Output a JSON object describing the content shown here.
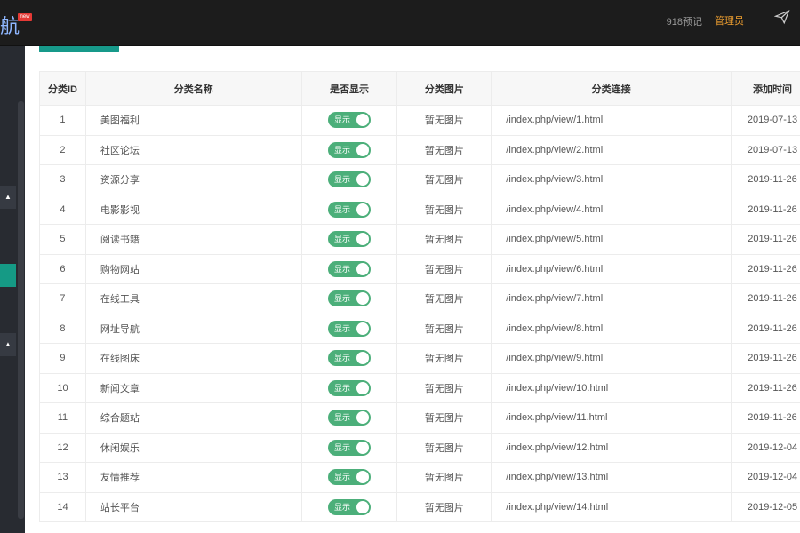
{
  "header": {
    "logo_text": "航",
    "logo_badge": "new",
    "stat_text": "918预记",
    "admin_label": "管理员",
    "send_icon": "paper-plane-icon"
  },
  "sidebar": {
    "items": [
      {
        "icon": "chevron-up-icon",
        "glyph": "▲"
      },
      {
        "icon": "chevron-up-icon",
        "glyph": "▲"
      }
    ],
    "active_color": "#159a85"
  },
  "colors": {
    "accent": "#17998a",
    "toggle_on": "#4caf7a"
  },
  "table": {
    "columns": [
      "分类ID",
      "分类名称",
      "是否显示",
      "分类图片",
      "分类连接",
      "添加时间"
    ],
    "toggle_label": "显示",
    "rows": [
      {
        "id": "1",
        "name": "美图福利",
        "show": "显示",
        "image": "暂无图片",
        "link": "/index.php/view/1.html",
        "time": "2019-07-13"
      },
      {
        "id": "2",
        "name": "社区论坛",
        "show": "显示",
        "image": "暂无图片",
        "link": "/index.php/view/2.html",
        "time": "2019-07-13"
      },
      {
        "id": "3",
        "name": "资源分享",
        "show": "显示",
        "image": "暂无图片",
        "link": "/index.php/view/3.html",
        "time": "2019-11-26"
      },
      {
        "id": "4",
        "name": "电影影视",
        "show": "显示",
        "image": "暂无图片",
        "link": "/index.php/view/4.html",
        "time": "2019-11-26"
      },
      {
        "id": "5",
        "name": "阅读书籍",
        "show": "显示",
        "image": "暂无图片",
        "link": "/index.php/view/5.html",
        "time": "2019-11-26"
      },
      {
        "id": "6",
        "name": "购物网站",
        "show": "显示",
        "image": "暂无图片",
        "link": "/index.php/view/6.html",
        "time": "2019-11-26"
      },
      {
        "id": "7",
        "name": "在线工具",
        "show": "显示",
        "image": "暂无图片",
        "link": "/index.php/view/7.html",
        "time": "2019-11-26"
      },
      {
        "id": "8",
        "name": "网址导航",
        "show": "显示",
        "image": "暂无图片",
        "link": "/index.php/view/8.html",
        "time": "2019-11-26"
      },
      {
        "id": "9",
        "name": "在线图床",
        "show": "显示",
        "image": "暂无图片",
        "link": "/index.php/view/9.html",
        "time": "2019-11-26"
      },
      {
        "id": "10",
        "name": "新闻文章",
        "show": "显示",
        "image": "暂无图片",
        "link": "/index.php/view/10.html",
        "time": "2019-11-26"
      },
      {
        "id": "11",
        "name": "综合题站",
        "show": "显示",
        "image": "暂无图片",
        "link": "/index.php/view/11.html",
        "time": "2019-11-26"
      },
      {
        "id": "12",
        "name": "休闲娱乐",
        "show": "显示",
        "image": "暂无图片",
        "link": "/index.php/view/12.html",
        "time": "2019-12-04"
      },
      {
        "id": "13",
        "name": "友情推荐",
        "show": "显示",
        "image": "暂无图片",
        "link": "/index.php/view/13.html",
        "time": "2019-12-04"
      },
      {
        "id": "14",
        "name": "站长平台",
        "show": "显示",
        "image": "暂无图片",
        "link": "/index.php/view/14.html",
        "time": "2019-12-05"
      }
    ]
  }
}
